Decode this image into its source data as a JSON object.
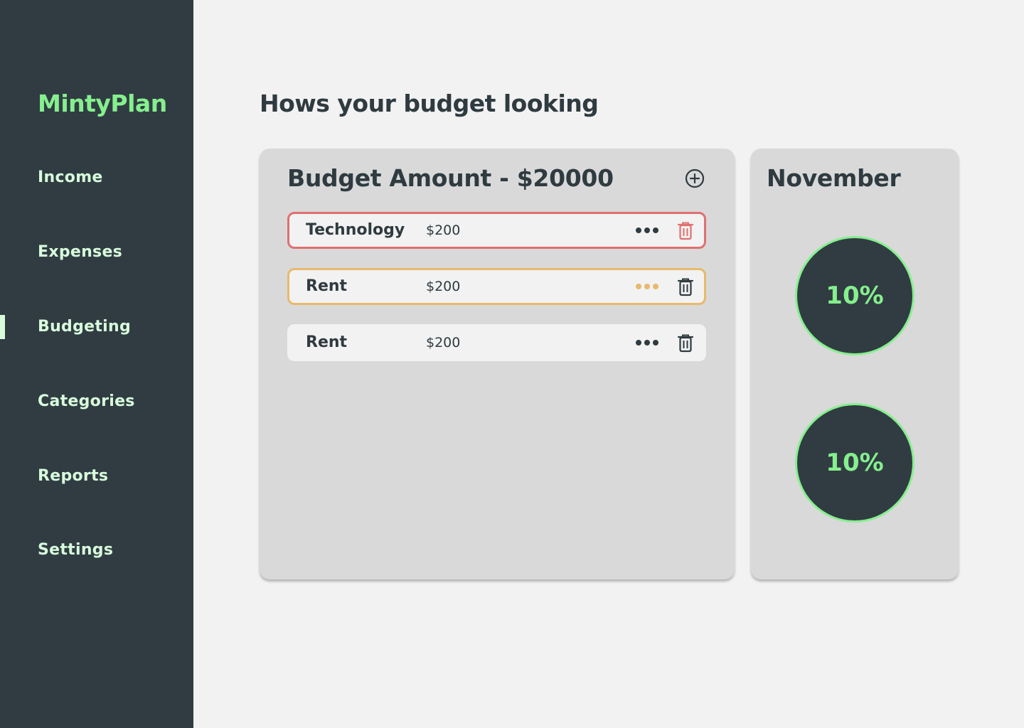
{
  "app": {
    "name": "MintyPlan"
  },
  "sidebar": {
    "items": [
      {
        "label": "Income",
        "active": false
      },
      {
        "label": "Expenses",
        "active": false
      },
      {
        "label": "Budgeting",
        "active": true
      },
      {
        "label": "Categories",
        "active": false
      },
      {
        "label": "Reports",
        "active": false
      },
      {
        "label": "Settings",
        "active": false
      }
    ]
  },
  "main": {
    "title": "Hows your budget looking",
    "budget": {
      "heading": "Budget Amount - $20000",
      "add_icon": "plus-circle-icon",
      "items": [
        {
          "name": "Technology",
          "amount": "$200",
          "status": "over",
          "status_color": "#e07070"
        },
        {
          "name": "Rent",
          "amount": "$200",
          "status": "warning",
          "status_color": "#e8b96c"
        },
        {
          "name": "Rent",
          "amount": "$200",
          "status": "normal",
          "status_color": "#2f3b40"
        }
      ]
    },
    "month": {
      "heading": "November",
      "stats": [
        {
          "value": "10%"
        },
        {
          "value": "10%"
        }
      ]
    }
  },
  "colors": {
    "sidebar_bg": "#303c42",
    "accent": "#86ef8e",
    "nav_text": "#d8fbdc",
    "danger": "#e07070",
    "warning": "#e8b96c"
  }
}
